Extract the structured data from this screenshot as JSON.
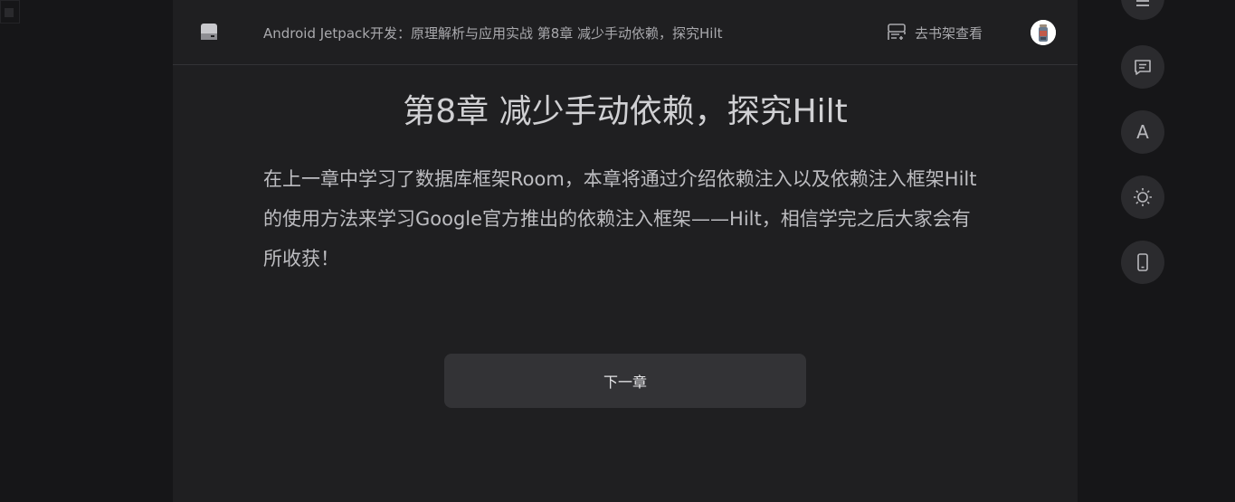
{
  "header": {
    "book_chapter_title": "Android Jetpack开发：原理解析与应用实战 第8章 减少手动依赖，探究Hilt",
    "shelf_link_label": "去书架查看"
  },
  "chapter": {
    "title": "第8章 减少手动依赖，探究Hilt",
    "body": "在上一章中学习了数据库框架Room，本章将通过介绍依赖注入以及依赖注入框架Hilt的使用方法来学习Google官方推出的依赖注入框架——Hilt，相信学完之后大家会有所收获！",
    "next_label": "下一章"
  },
  "right_rail": {
    "font_button_label": "A",
    "icons": [
      "menu-icon",
      "comment-icon",
      "font-icon",
      "brightness-icon",
      "phone-icon"
    ]
  },
  "colors": {
    "page_bg": "#161618",
    "reader_bg": "#1f1f21",
    "button_bg": "#333336",
    "rail_button_bg": "#2b2b2e"
  }
}
